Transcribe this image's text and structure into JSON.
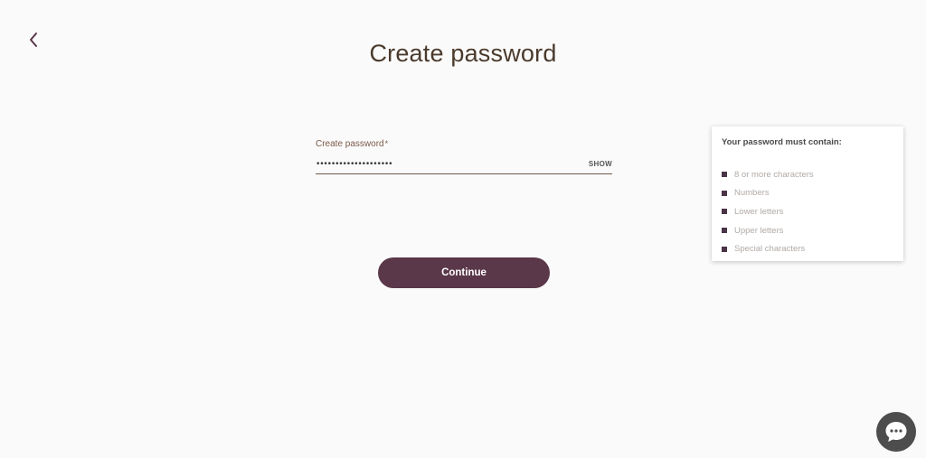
{
  "header": {
    "back_icon": "chevron-left-icon",
    "title": "Create password"
  },
  "password_field": {
    "label": "Create password",
    "required_marker": "*",
    "value": "••••••••••••••••••••",
    "show_label": "SHOW"
  },
  "continue_button": {
    "label": "Continue"
  },
  "requirements": {
    "title": "Your password must contain:",
    "items": [
      "8 or more characters",
      "Numbers",
      "Lower letters",
      "Upper letters",
      "Special characters"
    ]
  },
  "chat": {
    "icon": "chat-bubble-icon"
  },
  "colors": {
    "primary": "#5a3749",
    "title_text": "#4a3a2c",
    "bullet": "#4a3347",
    "rule_text": "#b0aaa6"
  }
}
